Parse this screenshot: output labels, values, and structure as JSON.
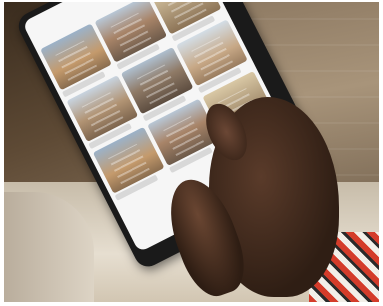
{
  "photo": {
    "description_free": true
  },
  "phone_screen": {
    "status_text": "",
    "header_text": "",
    "tiles": [
      {
        "id": "t1"
      },
      {
        "id": "t2"
      },
      {
        "id": "t3"
      },
      {
        "id": "t4"
      },
      {
        "id": "t5"
      },
      {
        "id": "t6"
      },
      {
        "id": "t1"
      },
      {
        "id": "t2"
      },
      {
        "id": "t3"
      }
    ]
  }
}
